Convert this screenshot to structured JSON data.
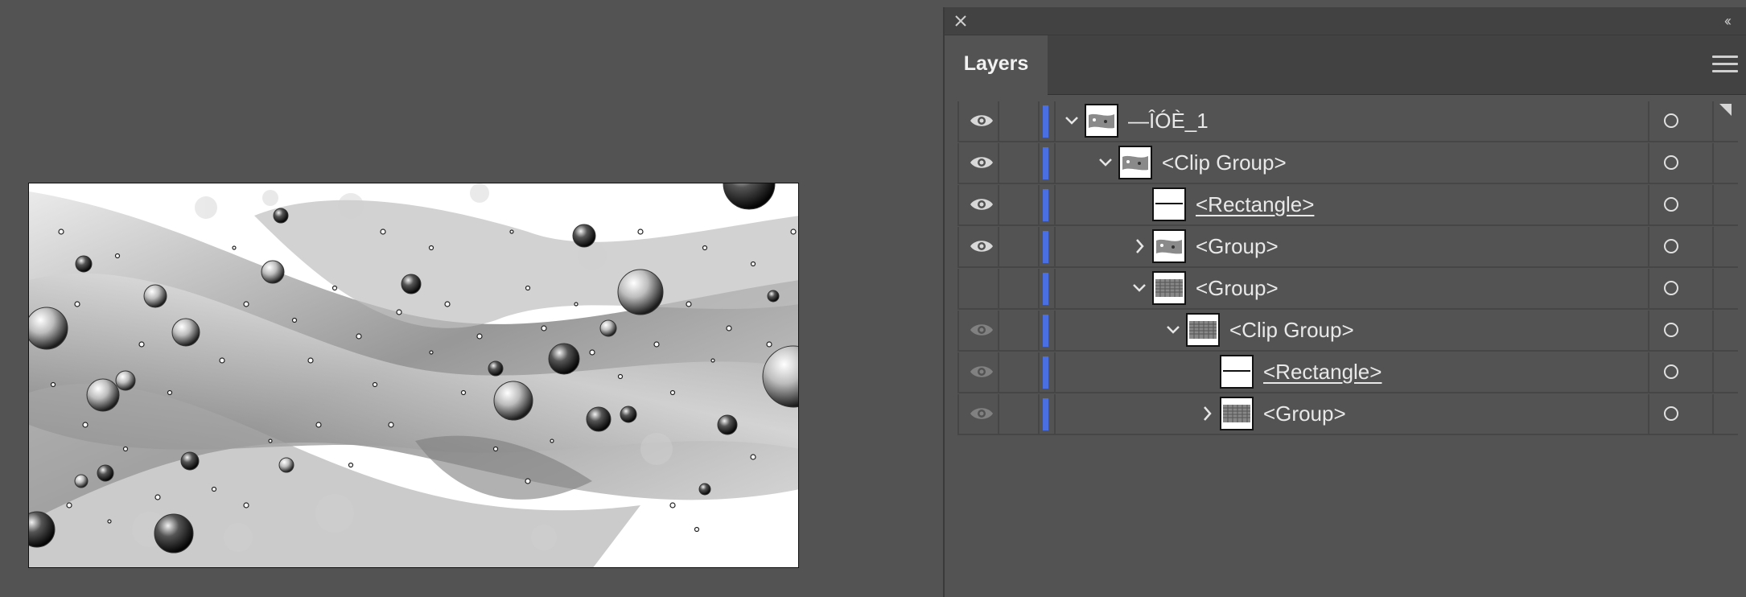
{
  "panel": {
    "tab_label": "Layers",
    "close_icon": "close-icon",
    "collapse_icon": "double-chevron-left-icon",
    "menu_icon": "hamburger-menu-icon",
    "layer_color": "#4a6fe3"
  },
  "layers": [
    {
      "name": "—ÎÓÈ_1",
      "visible": true,
      "expanded": true,
      "has_children": true,
      "underline": false
    },
    {
      "name": "<Clip Group>",
      "visible": true,
      "expanded": true,
      "has_children": true,
      "underline": false
    },
    {
      "name": "<Rectangle>",
      "visible": true,
      "expanded": false,
      "has_children": false,
      "underline": true
    },
    {
      "name": "<Group>",
      "visible": true,
      "expanded": false,
      "has_children": true,
      "underline": false
    },
    {
      "name": "<Group>",
      "visible": false,
      "expanded": true,
      "has_children": true,
      "underline": false
    },
    {
      "name": "<Clip Group>",
      "visible": "dim",
      "expanded": true,
      "has_children": true,
      "underline": false
    },
    {
      "name": "<Rectangle>",
      "visible": "dim",
      "expanded": false,
      "has_children": false,
      "underline": true
    },
    {
      "name": "<Group>",
      "visible": "dim",
      "expanded": false,
      "has_children": true,
      "underline": false
    }
  ]
}
